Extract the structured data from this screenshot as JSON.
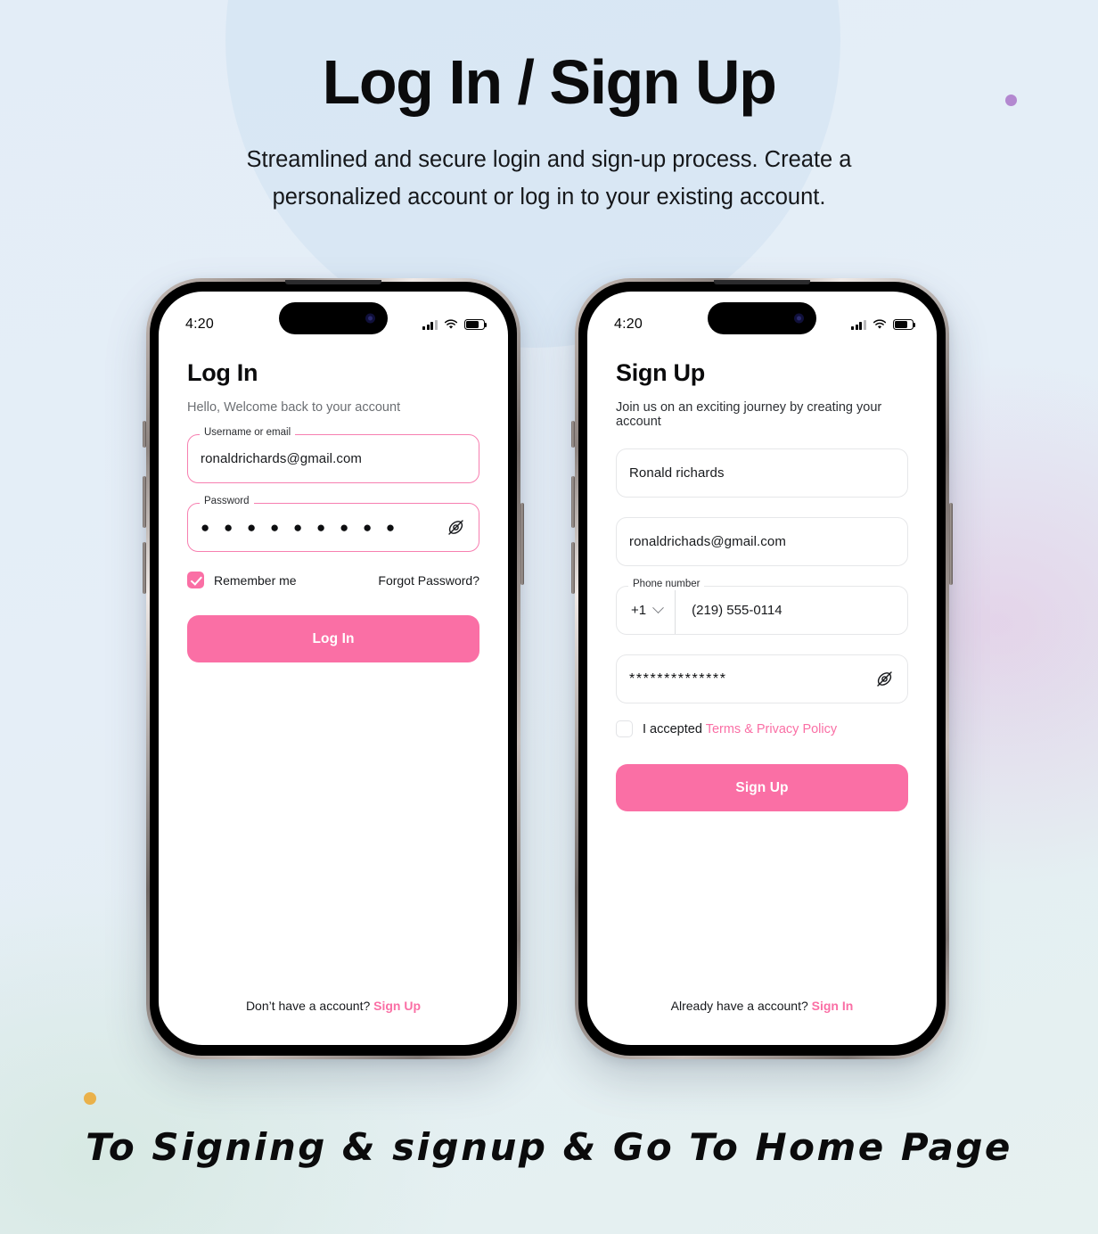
{
  "header": {
    "title": "Log In / Sign Up",
    "subtitle": "Streamlined and secure login and sign-up process. Create a personalized account or log in to your existing account."
  },
  "footer": {
    "caption": "To Signing & signup & Go To Home Page"
  },
  "colors": {
    "accent_pink": "#FA6FA5",
    "purple_dot": "#B388D0",
    "amber_dot": "#EAB14A",
    "background_blue": "#E3EDF7"
  },
  "login": {
    "status_bar": {
      "time": "4:20",
      "cellular": "signal-bars",
      "wifi": "wifi-icon",
      "battery": "battery-icon"
    },
    "title": "Log In",
    "subtitle": "Hello, Welcome back to your account",
    "username_field": {
      "label": "Username or email",
      "value": "ronaldrichards@gmail.com"
    },
    "password_field": {
      "label": "Password",
      "value": "● ● ● ● ● ● ● ● ●",
      "toggle_icon": "eye-off-icon"
    },
    "remember_me": {
      "label": "Remember me",
      "checked": true
    },
    "forgot_password": "Forgot Password?",
    "submit_label": "Log In",
    "bottom": {
      "text": "Don’t have a account? ",
      "link": "Sign Up"
    }
  },
  "signup": {
    "status_bar": {
      "time": "4:20",
      "cellular": "signal-bars",
      "wifi": "wifi-icon",
      "battery": "battery-icon"
    },
    "title": "Sign Up",
    "subtitle": "Join us on an exciting journey by creating your account",
    "name_field": {
      "placeholder": "Ronald richards",
      "value": "Ronald richards"
    },
    "email_field": {
      "placeholder": "ronaldrichads@gmail.com",
      "value": "ronaldrichads@gmail.com"
    },
    "phone_field": {
      "label": "Phone number",
      "country_code": "+1",
      "value": "(219) 555-0114",
      "chevron": "chevron-down-icon"
    },
    "password_field": {
      "value": "**************",
      "toggle_icon": "eye-off-icon"
    },
    "terms": {
      "prefix": "I accepted ",
      "link": "Terms & Privacy Policy",
      "checked": false
    },
    "submit_label": "Sign Up",
    "bottom": {
      "text": "Already have a account? ",
      "link": "Sign In"
    }
  }
}
